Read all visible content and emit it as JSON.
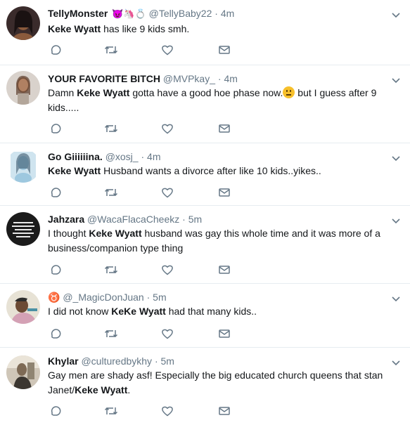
{
  "tweets": [
    {
      "name": "TellyMonster",
      "name_emoji": "😈🦄💍",
      "handle": "@TellyBaby22",
      "time": "4m",
      "text_bold": "Keke Wyatt",
      "text_after": " has like 9 kids smh.",
      "avatar_bg": "#3a2b2b",
      "avatar_skin": "#8a5a3c"
    },
    {
      "name": "YOUR FAVORITE BITCH",
      "handle": "@MVPkay_",
      "time": "4m",
      "text_before": "Damn ",
      "text_bold": "Keke Wyatt",
      "text_after": " gotta have a good hoe phase now.",
      "text_after_emoji": " but I guess after 9 kids.....",
      "avatar_bg": "#d9d2cc",
      "avatar_skin": "#b08062"
    },
    {
      "name": "Go Giiiiiina.",
      "handle": "@xosj_",
      "time": "4m",
      "text_bold": "Keke Wyatt",
      "text_after": " Husband wants a divorce after like 10 kids..yikes..",
      "avatar_bg": "#cfe4ef",
      "avatar_skin": "#9ec8df"
    },
    {
      "name": "Jahzara",
      "handle": "@WacaFlacaCheekz",
      "time": "5m",
      "text_before": "I thought ",
      "text_bold": "Keke Wyatt",
      "text_after": " husband was gay this whole time and it was more of a business/companion type thing",
      "avatar_bg": "#1b1b1b",
      "avatar_skin": "#e8e8e8"
    },
    {
      "name": "♉",
      "handle": "@_MagicDonJuan",
      "time": "5m",
      "text_before": "I did not know ",
      "text_bold": "KeKe Wyatt",
      "text_after": " had that many kids..",
      "avatar_bg": "#e7e2d5",
      "avatar_skin": "#6b4a34"
    },
    {
      "name": "Khylar",
      "handle": "@culturedbykhy",
      "time": "5m",
      "text_before": "Gay men are shady asf! Especially the big educated church queens that stan Janet/",
      "text_bold": "Keke Wyatt",
      "text_after": ".",
      "avatar_bg": "#cfc6b8",
      "avatar_skin": "#7e6a55"
    }
  ],
  "separator": "·",
  "colors": {
    "text": "#14171a",
    "secondary": "#657786",
    "divider": "#e6ecf0"
  }
}
